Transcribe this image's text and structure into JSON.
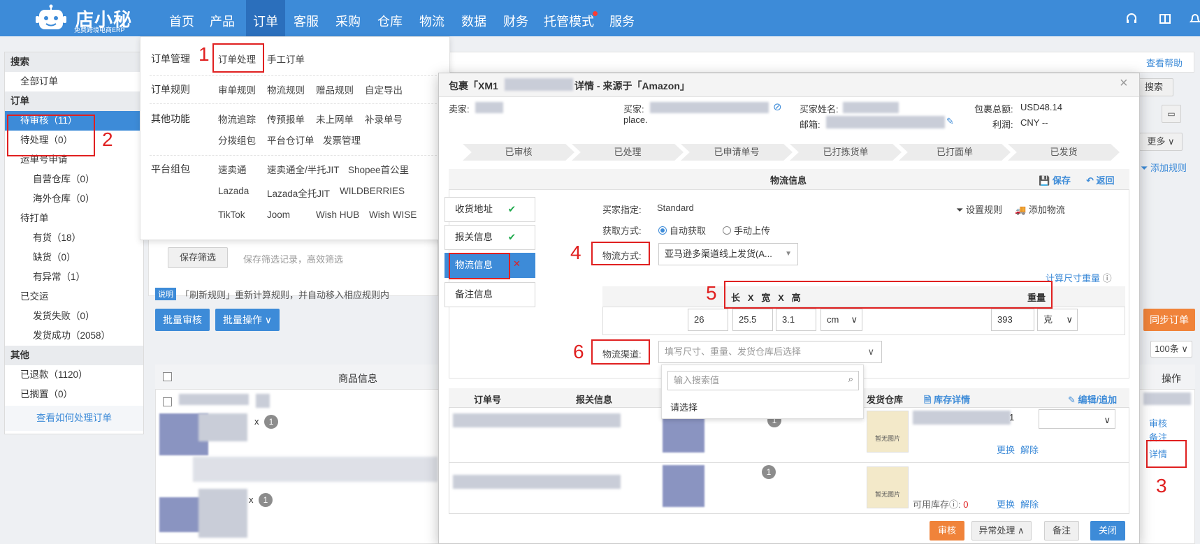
{
  "nav": {
    "logo_title": "店小秘",
    "logo_sub": "免费跨境电商ERP",
    "items": [
      "首页",
      "产品",
      "订单",
      "客服",
      "采购",
      "仓库",
      "物流",
      "数据",
      "财务",
      "托管模式",
      "服务"
    ]
  },
  "sidebar": {
    "search": "搜索",
    "all_orders": "全部订单",
    "orders": "订单",
    "pending_review": "待审核（11）",
    "pending_process": "待处理（0）",
    "waybill_apply": "运单号申请",
    "self_wh": "自营仓库（0）",
    "overseas_wh": "海外仓库（0）",
    "to_print": "待打单",
    "in_stock": "有货（18）",
    "out_of_stock": "缺货（0）",
    "abnormal": "有异常（1）",
    "delivered": "已交运",
    "ship_fail": "发货失败（0）",
    "ship_ok": "发货成功（2058）",
    "other": "其他",
    "refunded": "已退款（1120）",
    "shelved": "已搁置（0）",
    "howto": "查看如何处理订单"
  },
  "menu": {
    "cat_order_mgmt": "订单管理",
    "order_process": "订单处理",
    "manual_order": "手工订单",
    "cat_rules": "订单规则",
    "rules": [
      "审单规则",
      "物流规则",
      "赠品规则",
      "自定导出"
    ],
    "cat_other": "其他功能",
    "other_row1": [
      "物流追踪",
      "传预报单",
      "未上网单",
      "补录单号"
    ],
    "other_row2": [
      "分拨组包",
      "平台仓订单",
      "发票管理"
    ],
    "cat_platform": "平台组包",
    "plat_row1": [
      "速卖通",
      "速卖通全/半托JIT",
      "Shopee首公里"
    ],
    "plat_row2": [
      "Lazada",
      "Lazada全托JIT",
      "WILDBERRIES"
    ],
    "plat_row3": [
      "TikTok",
      "Joom",
      "Wish HUB",
      "Wish WISE"
    ]
  },
  "bg": {
    "help": "查看帮助",
    "search_btn": "搜索",
    "more": "更多",
    "add_rule": "添加规则",
    "save_filter": "保存筛选",
    "save_filter_hint": "保存筛选记录，高效筛选",
    "note_tag": "说明",
    "note_text": "「刷新规则」重新计算规则，并自动移入相应规则内",
    "batch_review": "批量审核",
    "batch_ops": "批量操作",
    "sync_order": "同步订单",
    "per_page": "100条",
    "col_product": "商品信息",
    "col_action": "操作",
    "act_review": "审核",
    "act_note": "备注",
    "act_detail": "详情",
    "qty_1": "1",
    "x_mark": "x"
  },
  "modal": {
    "title_prefix": "包裹「XM1",
    "title_suffix": "详情 - 来源于「Amazon」",
    "seller": "卖家:",
    "buyer": "买家:",
    "buyer_line2": "place.",
    "buyer_name": "买家姓名:",
    "email": "邮箱:",
    "pkg_total": "包裹总额:",
    "pkg_total_val": "USD48.14",
    "profit": "利润:",
    "profit_val": "CNY --",
    "steps": [
      "已审核",
      "已处理",
      "已申请单号",
      "已打拣货单",
      "已打面单",
      "已发货"
    ],
    "section_title": "物流信息",
    "save": "保存",
    "back": "返回",
    "tabs": [
      "收货地址",
      "报关信息",
      "物流信息",
      "备注信息"
    ],
    "buyer_spec_label": "买家指定:",
    "buyer_spec_val": "Standard",
    "fetch_label": "获取方式:",
    "fetch_auto": "自动获取",
    "fetch_manual": "手动上传",
    "set_rule": "设置规则",
    "add_logistics": "添加物流",
    "method_label": "物流方式:",
    "method_val": "亚马逊多渠道线上发货(A...",
    "calc_weight": "计算尺寸重量",
    "dim_header": "长   X   宽   X   高",
    "weight_header": "重量",
    "len": "26",
    "wid": "25.5",
    "hei": "3.1",
    "unit": "cm",
    "weight": "393",
    "weight_unit": "克",
    "channel_label": "物流渠道:",
    "channel_placeholder": "填写尺寸、重量、发货仓库后选择",
    "search_placeholder": "输入搜索值",
    "please_select": "请选择",
    "col_order_no": "订单号",
    "col_customs": "报关信息",
    "col_wh": "发货仓库",
    "stock_detail": "库存详情",
    "edit_add": "编辑/追加",
    "no_img": "暂无图片",
    "replace": "更换",
    "unbind": "解除",
    "avail_stock": "可用库存",
    "avail_val": "0",
    "qty": "1",
    "btn_review": "审核",
    "btn_abnormal": "异常处理",
    "btn_note": "备注",
    "btn_close": "关闭"
  },
  "annotations": [
    "1",
    "2",
    "3",
    "4",
    "5",
    "6"
  ],
  "colors": {
    "brand": "#3d8bd8",
    "annotation": "#e02020",
    "orange": "#f0833a"
  }
}
